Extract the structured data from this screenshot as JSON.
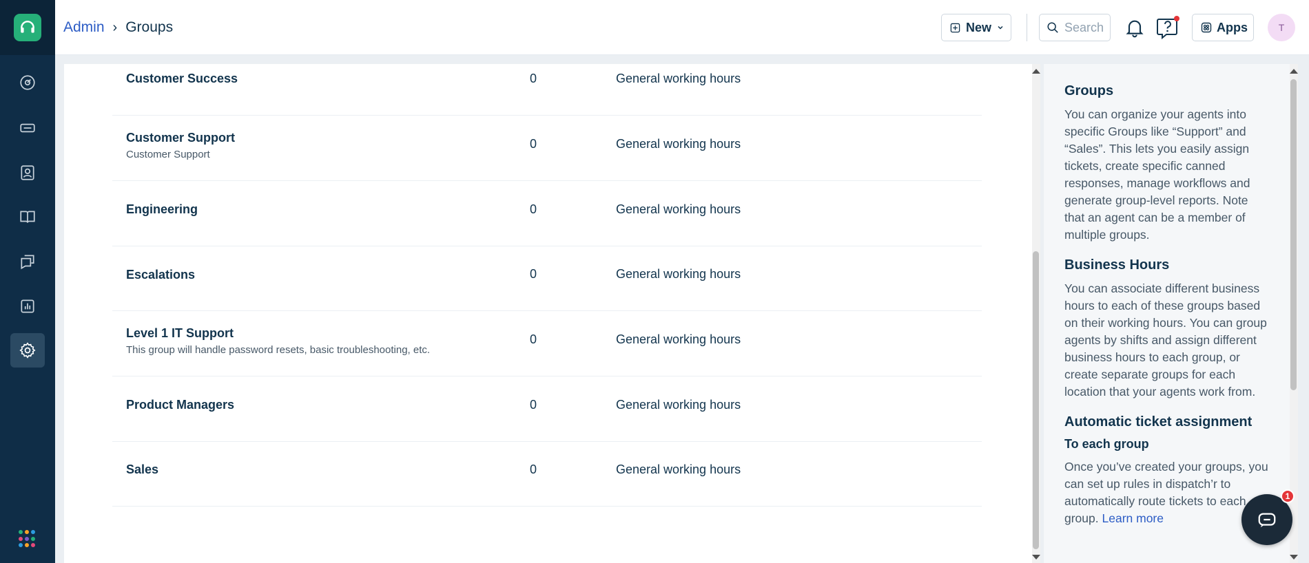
{
  "breadcrumb": {
    "parent": "Admin",
    "separator": "›",
    "current": "Groups"
  },
  "topbar": {
    "new_label": "New",
    "search_placeholder": "Search",
    "apps_label": "Apps",
    "avatar_initial": "T"
  },
  "groups": [
    {
      "name": "Customer Success",
      "description": "",
      "count": "0",
      "hours": "General working hours"
    },
    {
      "name": "Customer Support",
      "description": "Customer Support",
      "count": "0",
      "hours": "General working hours"
    },
    {
      "name": "Engineering",
      "description": "",
      "count": "0",
      "hours": "General working hours"
    },
    {
      "name": "Escalations",
      "description": "",
      "count": "0",
      "hours": "General working hours"
    },
    {
      "name": "Level 1 IT Support",
      "description": "This group will handle password resets, basic troubleshooting, etc.",
      "count": "0",
      "hours": "General working hours"
    },
    {
      "name": "Product Managers",
      "description": "",
      "count": "0",
      "hours": "General working hours"
    },
    {
      "name": "Sales",
      "description": "",
      "count": "0",
      "hours": "General working hours"
    }
  ],
  "help": {
    "groups_title": "Groups",
    "groups_text": "You can organize your agents into specific Groups like “Support” and “Sales”. This lets you easily assign tickets, create specific canned responses, manage workflows and generate group-level reports. Note that an agent can be a member of multiple groups.",
    "hours_title": "Business Hours",
    "hours_text": "You can associate different business hours to each of these groups based on their working hours. You can group agents by shifts and assign different business hours to each group, or create separate groups for each location that your agents work from.",
    "auto_title": "Automatic ticket assignment",
    "auto_sub": "To each group",
    "auto_text": "Once you’ve created your groups, you can set up rules in dispatch’r to automatically route tickets to each group.",
    "learn_more": "Learn more"
  },
  "chat": {
    "badge_count": "1"
  },
  "nav_icons": [
    "dashboard-icon",
    "tickets-icon",
    "contacts-icon",
    "solutions-icon",
    "forums-icon",
    "reports-icon",
    "admin-gear-icon"
  ],
  "colors": {
    "nav_bg": "#0f2d47",
    "brand_green": "#26b079",
    "link_blue": "#2c5cc5",
    "badge_red": "#e43538"
  }
}
